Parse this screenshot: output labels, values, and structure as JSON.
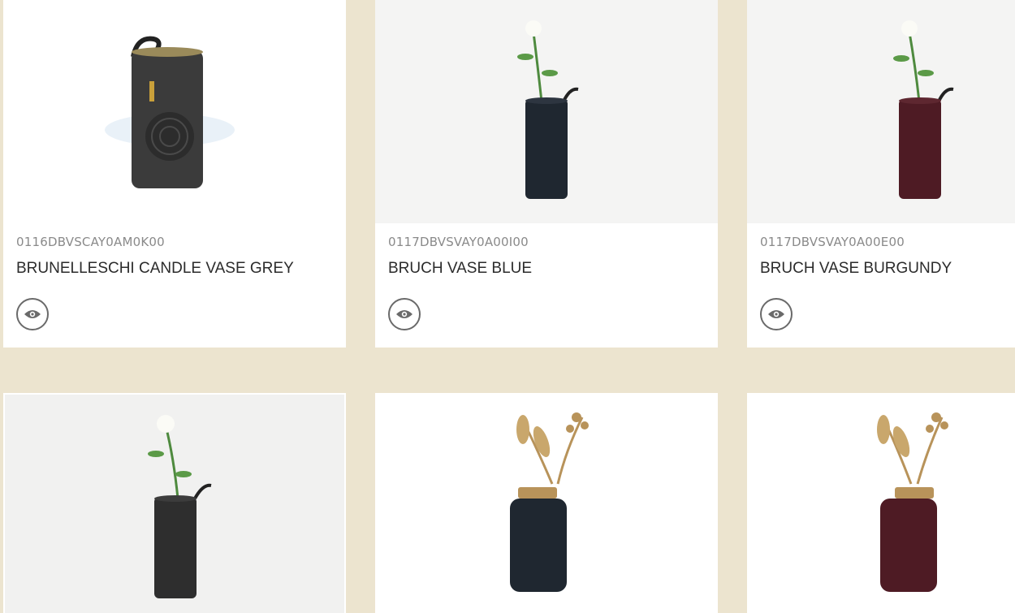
{
  "products": [
    {
      "sku": "0116DBVSCAY0AM0K00",
      "title": "BRUNELLESCHI CANDLE VASE GREY",
      "view_icon": "eye-icon"
    },
    {
      "sku": "0117DBVSVAY0A00I00",
      "title": "BRUCH VASE BLUE",
      "view_icon": "eye-icon"
    },
    {
      "sku": "0117DBVSVAY0A00E00",
      "title": "BRUCH VASE BURGUNDY",
      "view_icon": "eye-icon"
    }
  ],
  "colors": {
    "page_background": "#ece4cf",
    "card_background": "#ffffff",
    "vase_grey": "#3b3b3b",
    "vase_blue": "#1f2730",
    "vase_burgundy": "#4e1b24",
    "brass": "#b8935a"
  }
}
